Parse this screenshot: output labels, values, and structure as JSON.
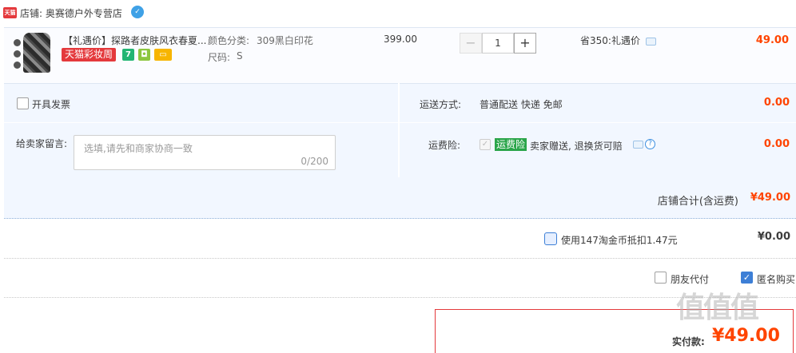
{
  "shop": {
    "badge": "天猫",
    "name": "店铺: 奥赛德户外专营店"
  },
  "item": {
    "title": "【礼遇价】探路者皮肤风衣春夏...",
    "promo_badge": "天猫彩妆周",
    "mini_badge_1": "7",
    "color_label": "颜色分类:",
    "color_value": "309黑白印花",
    "size_label": "尺码:",
    "size_value": "S",
    "unit_price": "399.00",
    "quantity": "1",
    "minus": "−",
    "plus": "+",
    "saving": "省350:礼遇价",
    "total": "49.00"
  },
  "options": {
    "invoice_label": "开具发票",
    "message_label": "给卖家留言:",
    "message_placeholder": "选填,请先和商家协商一致",
    "message_count": "0/200",
    "shipping_label": "运送方式:",
    "shipping_value": "普通配送 快递 免邮",
    "shipping_amount": "0.00",
    "insurance_label": "运费险:",
    "insurance_badge": "运费险",
    "insurance_desc": "卖家赠送, 退换货可赔",
    "insurance_amount": "0.00"
  },
  "shop_total": {
    "label": "店铺合计(含运费)",
    "value": "¥49.00"
  },
  "coins": {
    "label": "使用147淘金币抵扣1.47元",
    "value": "¥0.00"
  },
  "extra": {
    "friend_pay": "朋友代付",
    "anonymous": "匿名购买"
  },
  "pay": {
    "label": "实付款:",
    "amount": "¥49.00"
  },
  "watermark": "值值值",
  "colors": {
    "accent_red": "#ff4400",
    "tmall_red": "#e4393c",
    "panel_blue": "#f2f7ff",
    "insurance_green": "#2aa54a"
  }
}
